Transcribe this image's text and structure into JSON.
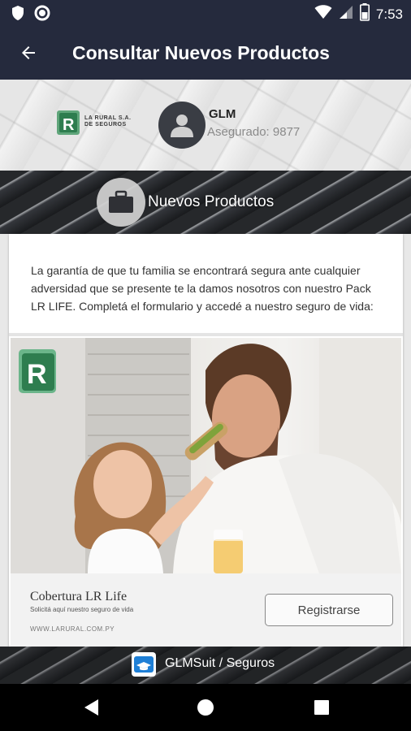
{
  "status_bar": {
    "time": "7:53",
    "icons": [
      "shield-icon",
      "circle-icon",
      "wifi-icon",
      "signal-icon",
      "battery-icon"
    ]
  },
  "app_bar": {
    "title": "Consultar Nuevos Productos",
    "back_icon": "arrow-left-icon"
  },
  "header": {
    "logo_line1": "LA RURAL S.A.",
    "logo_line2": "DE SEGUROS",
    "user_name": "GLM",
    "user_sub": "Asegurado: 9877"
  },
  "section": {
    "title": "Nuevos Productos",
    "icon": "briefcase-icon"
  },
  "card": {
    "description": "La garantía de que tu familia se encontrará segura ante cualquier adversidad que se presente te la damos nosotros con nuestro Pack LR LIFE. Completá el formulario y accedé a nuestro seguro de vida:",
    "promo_title": "Cobertura LR Life",
    "promo_sub": "Solicitá aquí nuestro seguro de vida",
    "promo_url": "WWW.LARURAL.COM.PY",
    "register_label": "Registrarse"
  },
  "brand_bar": {
    "text": "GLMSuit / Seguros"
  },
  "colors": {
    "app_bar": "#252a3d",
    "brand_green": "#2e7d4f"
  }
}
